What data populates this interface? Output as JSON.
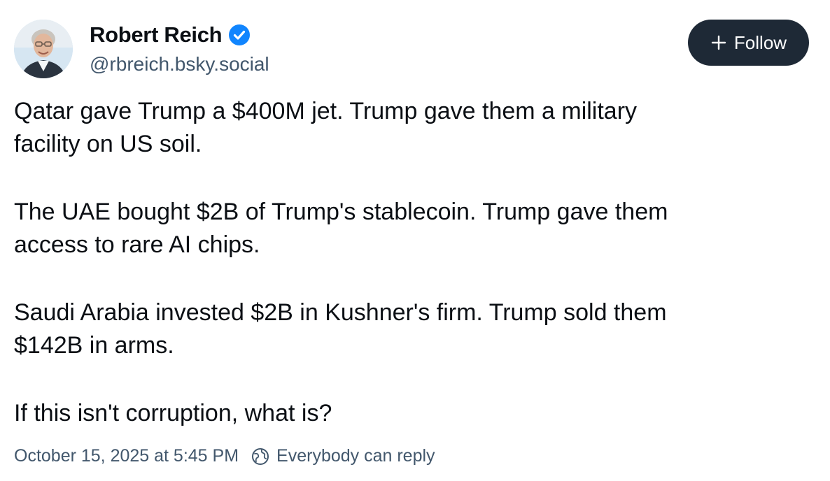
{
  "author": {
    "display_name": "Robert Reich",
    "handle": "@rbreich.bsky.social",
    "verified": true,
    "verified_icon": "verified-badge-icon",
    "avatar": "avatar"
  },
  "follow_button": {
    "label": "Follow",
    "icon": "plus-icon"
  },
  "post": {
    "paragraphs": [
      "Qatar gave Trump a $400M jet. Trump gave them a military\nfacility on US soil.",
      "The UAE bought $2B of Trump's stablecoin. Trump gave them\naccess to rare AI chips.",
      "Saudi Arabia invested $2B in Kushner's firm. Trump sold them\n$142B in arms.",
      "If this isn't corruption, what is?"
    ]
  },
  "meta": {
    "timestamp": "October 15, 2025 at 5:45 PM",
    "reply_setting_icon": "globe-icon",
    "reply_setting": "Everybody can reply"
  },
  "colors": {
    "follow_bg": "#1e2936",
    "verified_blue": "#1185fe",
    "secondary_text": "#42576c"
  }
}
